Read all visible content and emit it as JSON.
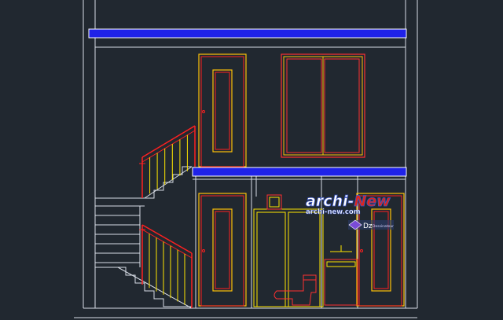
{
  "viewer": {
    "background_color": "#212830"
  },
  "drawing": {
    "type": "cad-building-section-elevation",
    "colors": {
      "wall_lines": "#d8dde6",
      "slab_fill": "#1f22e8",
      "slab_outline": "#ffffff",
      "door_outer": "#ffc107",
      "door_inner": "#ff2020",
      "window_frame": "#ff3030",
      "stair_steps": "#d8dde6",
      "railing_rail": "#ff2020",
      "railing_balusters": "#ffe600",
      "fixture_lines": "#ffe600",
      "toilet": "#ff3030"
    },
    "elements": [
      {
        "name": "roof-slab",
        "kind": "slab"
      },
      {
        "name": "floor-slab-level-1",
        "kind": "slab"
      },
      {
        "name": "upper-door",
        "kind": "door"
      },
      {
        "name": "upper-window",
        "kind": "window-two-pane"
      },
      {
        "name": "lower-left-door",
        "kind": "door"
      },
      {
        "name": "lower-right-door",
        "kind": "door"
      },
      {
        "name": "upper-stair-flight",
        "kind": "stair"
      },
      {
        "name": "lower-stair-flight",
        "kind": "stair"
      },
      {
        "name": "upper-stair-railing",
        "kind": "railing"
      },
      {
        "name": "lower-stair-railing",
        "kind": "railing"
      },
      {
        "name": "bathroom-toilet",
        "kind": "fixture"
      },
      {
        "name": "bathroom-sink",
        "kind": "fixture"
      }
    ]
  },
  "watermark": {
    "brand_main": "archi",
    "brand_sep": "-",
    "brand_accent": "New",
    "url": "archi-new.com",
    "badge_text": "Dz",
    "badge_caption": "Dessinateur",
    "colors": {
      "brand_fill": "#ffffff",
      "brand_stroke": "#3a56c8",
      "accent_fill": "#e0241a",
      "url_fill": "#ffffff",
      "url_stroke": "#3a56c8"
    }
  }
}
